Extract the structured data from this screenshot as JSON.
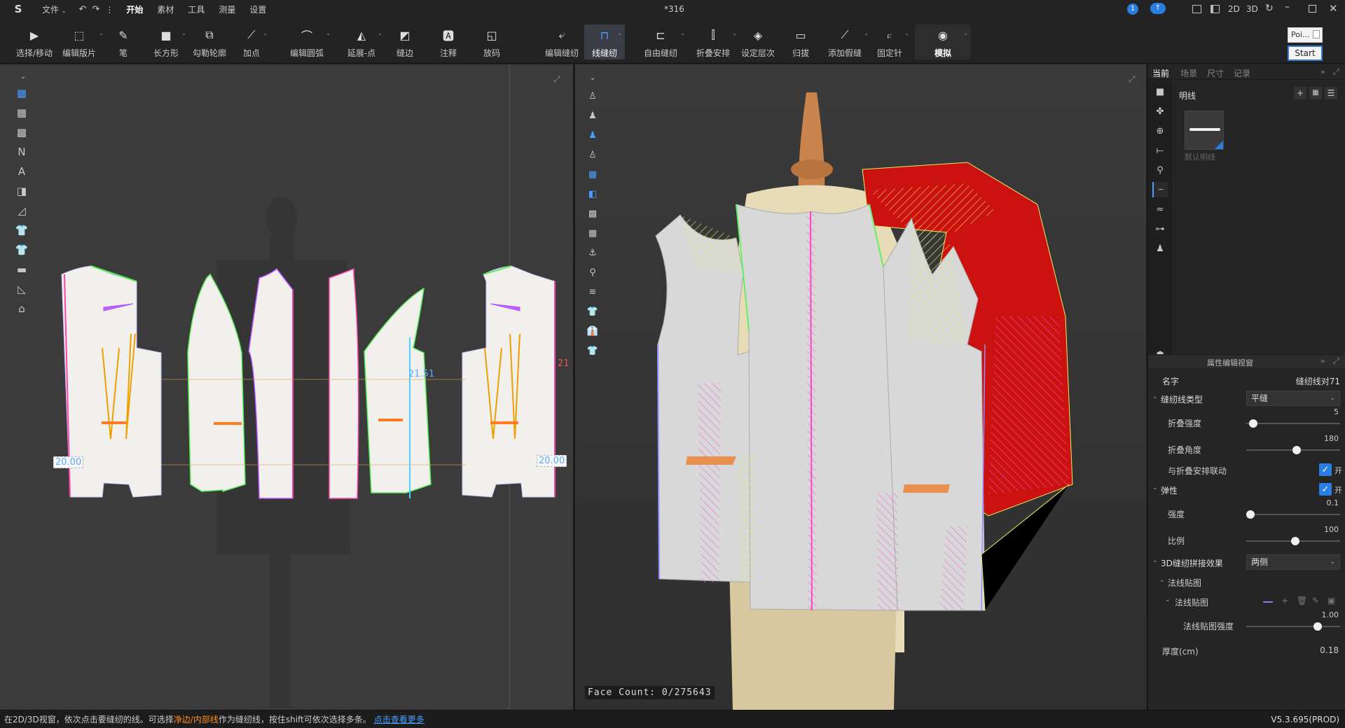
{
  "topbar": {
    "menu": [
      "文件",
      "开始",
      "素材",
      "工具",
      "测量",
      "设置"
    ],
    "file_menu": "文件",
    "title": "*316",
    "notify_count": "1",
    "view_2d": "2D",
    "view_3d": "3D"
  },
  "toolbar": {
    "left": [
      {
        "label": "选择/移动",
        "icon": "cursor-icon"
      },
      {
        "label": "编辑版片",
        "icon": "edit-pattern-icon"
      },
      {
        "label": "笔",
        "icon": "pen-icon"
      },
      {
        "label": "长方形",
        "icon": "rectangle-icon"
      },
      {
        "label": "勾勒轮廓",
        "icon": "trace-outline-icon"
      },
      {
        "label": "加点",
        "icon": "add-point-icon"
      },
      {
        "label": "编辑圆弧",
        "icon": "edit-arc-icon"
      },
      {
        "label": "延展-点",
        "icon": "extend-point-icon"
      },
      {
        "label": "缝边",
        "icon": "seam-allowance-icon"
      },
      {
        "label": "注释",
        "icon": "annotation-icon"
      },
      {
        "label": "放码",
        "icon": "grading-icon"
      }
    ],
    "right": [
      {
        "label": "编辑缝纫",
        "icon": "edit-sewing-icon"
      },
      {
        "label": "线缝纫",
        "icon": "line-sewing-icon"
      },
      {
        "label": "自由缝纫",
        "icon": "free-sewing-icon"
      },
      {
        "label": "折叠安排",
        "icon": "fold-arrange-icon"
      },
      {
        "label": "设定层次",
        "icon": "set-layer-icon"
      },
      {
        "label": "归拔",
        "icon": "shrink-stretch-icon"
      },
      {
        "label": "添加假缝",
        "icon": "add-tack-icon"
      },
      {
        "label": "固定针",
        "icon": "pin-icon"
      },
      {
        "label": "模拟",
        "icon": "simulate-icon"
      }
    ],
    "search_placeholder": "Poi...",
    "start_label": "Start"
  },
  "view2d": {
    "measure_left": "20.00",
    "measure_right": "20.00",
    "measure_mid": "21.51",
    "measure_edge": "21"
  },
  "view3d": {
    "face_count": "Face Count: 0/275643"
  },
  "right": {
    "tabs": [
      "当前",
      "场景",
      "尺寸",
      "记录"
    ],
    "section_title": "明线",
    "thumb_label": "默认明线",
    "prop_title": "属性编辑视窗",
    "name_label": "名字",
    "name_value": "缝纫线对71",
    "seam_type_label": "缝纫线类型",
    "seam_type_value": "平缝",
    "fold_strength_label": "折叠强度",
    "fold_strength_value": "5",
    "fold_angle_label": "折叠角度",
    "fold_angle_value": "180",
    "fold_link_label": "与折叠安排联动",
    "fold_link_value": "开",
    "elastic_label": "弹性",
    "elastic_value": "开",
    "strength_label": "强度",
    "strength_value": "0.1",
    "ratio_label": "比例",
    "ratio_value": "100",
    "merge_label": "3D缝纫拼接效果",
    "merge_value": "两侧",
    "normal_map_group": "法线贴图",
    "normal_map_sub": "法线贴图",
    "normal_strength_label": "法线贴图强度",
    "normal_strength_value": "1.00",
    "thickness_label": "厚度(cm)",
    "thickness_value": "0.18"
  },
  "status": {
    "msg_a": "在2D/3D视窗，依次点击要缝纫的线。可选择",
    "msg_highlight": "净边/内部线",
    "msg_b": "作为缝纫线，按住shift可依次选择多条。",
    "link": "点击查看更多",
    "version": "V5.3.695(PROD)"
  },
  "colors": {
    "accent": "#2a7de1",
    "red_fabric": "#cc1111",
    "highlight": "#ff8c1a"
  }
}
